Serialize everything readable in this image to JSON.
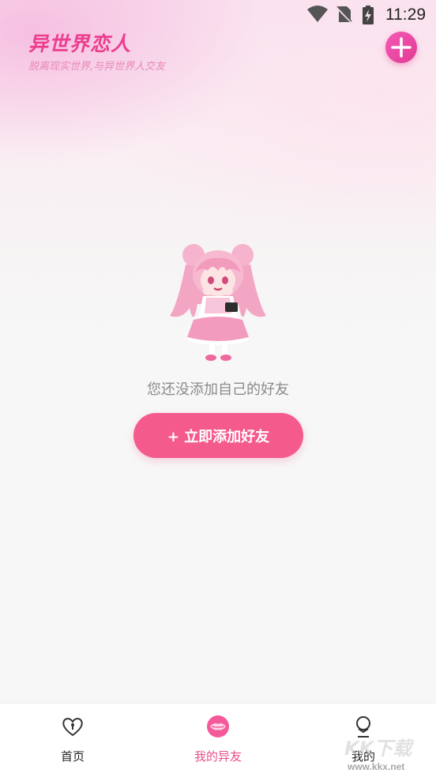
{
  "status_bar": {
    "time": "11:29",
    "icons": [
      "wifi-icon",
      "no-sim-icon",
      "battery-charging-icon"
    ]
  },
  "header": {
    "title": "异世界恋人",
    "subtitle": "脱离现实世界,与异世界人交友",
    "add_button_icon": "plus-icon"
  },
  "empty_state": {
    "illustration": "anime-girl-illustration",
    "message": "您还没添加自己的好友",
    "button_label": "+ 立即添加好友"
  },
  "bottom_nav": {
    "items": [
      {
        "label": "首页",
        "icon": "heart-lock-icon",
        "active": false
      },
      {
        "label": "我的异友",
        "icon": "lips-icon",
        "active": true
      },
      {
        "label": "我的",
        "icon": "user-icon",
        "active": false
      }
    ]
  },
  "watermark": {
    "text": "KK下载",
    "url": "www.kkx.net"
  },
  "colors": {
    "accent": "#f55a8d",
    "title": "#ec3d8e",
    "active_tab": "#ea4f8c"
  }
}
